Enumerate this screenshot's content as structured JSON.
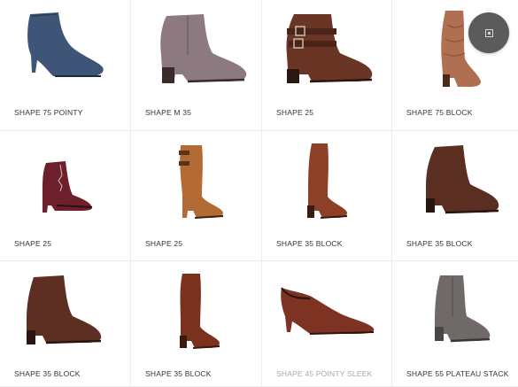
{
  "products": [
    {
      "name": "SHAPE 75 POINTY",
      "shape": "pointy-bootie",
      "color": "#3f5577",
      "faded": false
    },
    {
      "name": "SHAPE M 35",
      "shape": "ankle-zip",
      "color": "#8c7a80",
      "faded": false
    },
    {
      "name": "SHAPE 25",
      "shape": "buckle-ankle",
      "color": "#6a3524",
      "faded": false
    },
    {
      "name": "SHAPE 75 BLOCK",
      "shape": "slouch-tall",
      "color": "#b06f50",
      "faded": false
    },
    {
      "name": "SHAPE 25",
      "shape": "lace-up",
      "color": "#6e1f2c",
      "faded": false
    },
    {
      "name": "SHAPE 25",
      "shape": "tall-buckle",
      "color": "#b46a35",
      "faded": false
    },
    {
      "name": "SHAPE 35 BLOCK",
      "shape": "tall-riding",
      "color": "#8d4028",
      "faded": false
    },
    {
      "name": "SHAPE 35 BLOCK",
      "shape": "block-ankle",
      "color": "#5b2e22",
      "faded": false
    },
    {
      "name": "SHAPE 35 BLOCK",
      "shape": "block-ankle",
      "color": "#5c2f22",
      "faded": false
    },
    {
      "name": "SHAPE 35 BLOCK",
      "shape": "tall-riding",
      "color": "#7a321f",
      "faded": false
    },
    {
      "name": "SHAPE 45 POINTY SLEEK",
      "shape": "pointy-shootie",
      "color": "#7e3322",
      "faded": true
    },
    {
      "name": "SHAPE 55 PLATEAU STACK",
      "shape": "stack-ankle",
      "color": "#6f6a67",
      "faded": false
    }
  ],
  "overlay_button": {
    "icon": "square-icon"
  }
}
